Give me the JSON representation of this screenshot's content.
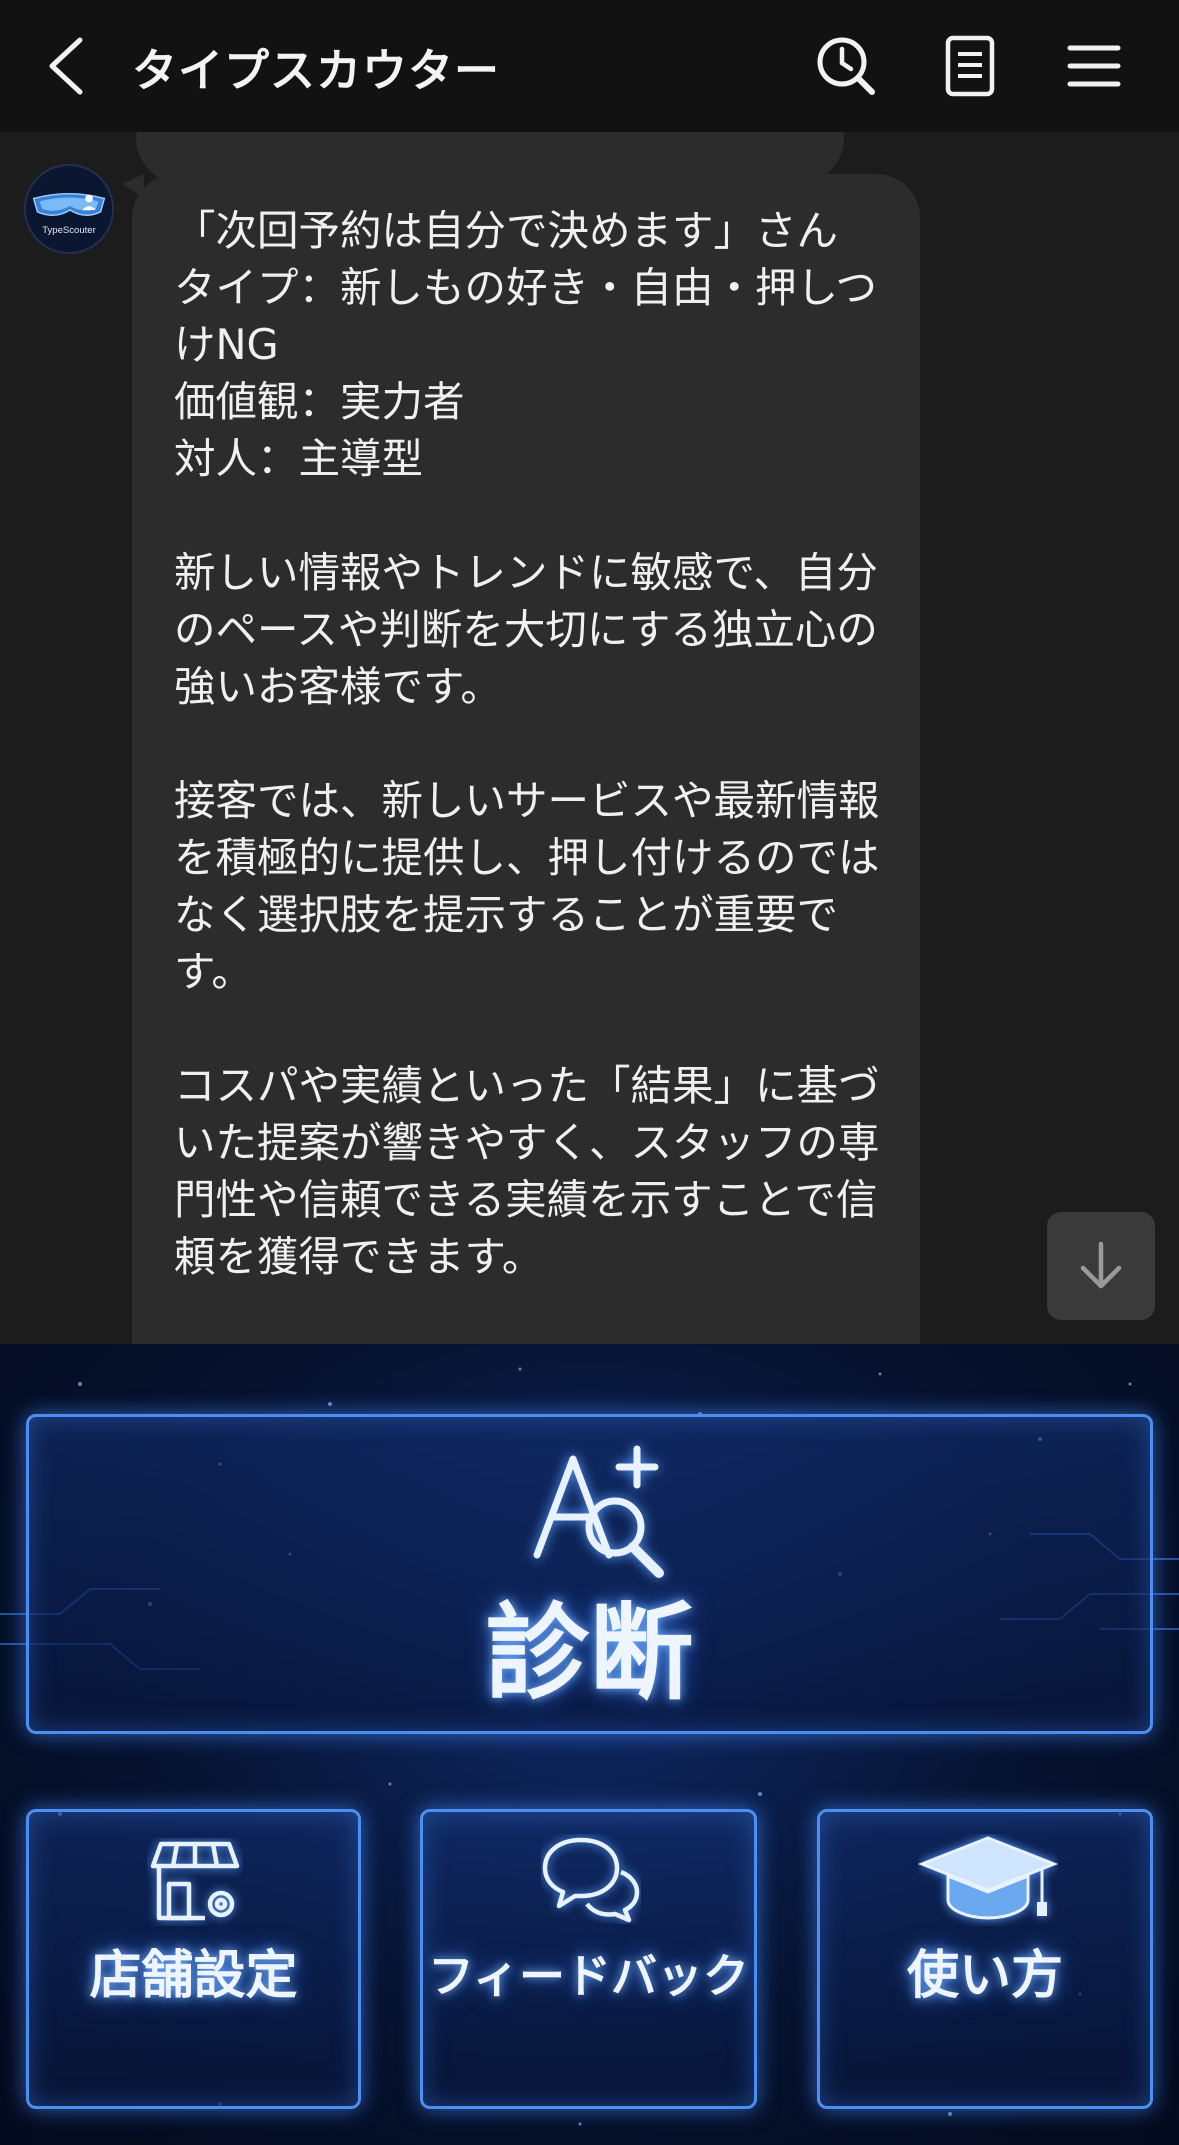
{
  "header": {
    "title": "タイプスカウター",
    "icons": [
      "back-arrow-icon",
      "search-clock-icon",
      "notes-icon",
      "menu-icon"
    ]
  },
  "chat": {
    "avatar_label": "TypeScouter",
    "message": "「次回予約は自分で決めます」さん\nタイプ：新しもの好き・自由・押しつけNG\n価値観：実力者\n対人：主導型\n\n新しい情報やトレンドに敏感で、自分のペースや判断を大切にする独立心の強いお客様です。\n\n接客では、新しいサービスや最新情報を積極的に提供し、押し付けるのではなく選択肢を提示することが重要です。\n\nコスパや実績といった「結果」に基づいた提案が響きやすく、スタッフの専門性や信頼できる実績を示すことで信頼を獲得できます。"
  },
  "menu": {
    "main_label": "診断",
    "main_icon": "a-plus-magnifier-icon",
    "buttons": [
      {
        "label": "店舗設定",
        "icon": "store-settings-icon"
      },
      {
        "label": "フィードバック",
        "icon": "chat-bubbles-icon"
      },
      {
        "label": "使い方",
        "icon": "graduation-cap-icon"
      }
    ]
  },
  "colors": {
    "header_bg": "#121212",
    "chat_bg": "#1c1c1c",
    "bubble_bg": "#2c2c2c",
    "menu_glow": "#4c8ff0"
  }
}
